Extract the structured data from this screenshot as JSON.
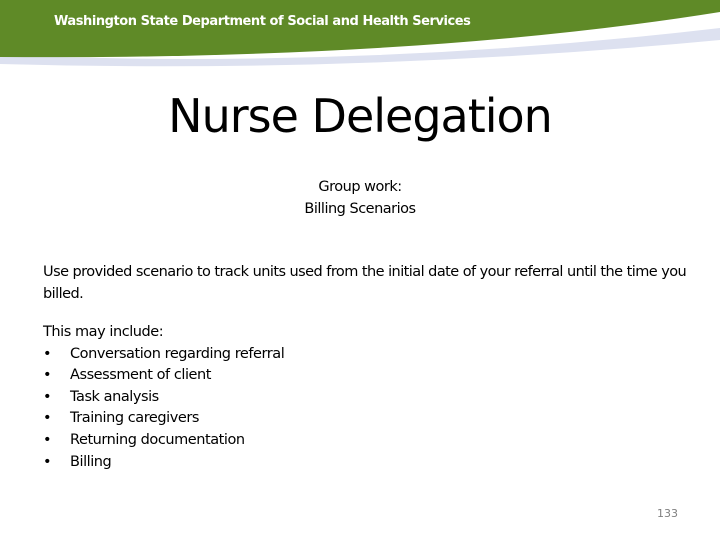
{
  "header": {
    "organization": "Washington State Department of Social and Health Services",
    "brand_color": "#5f8a27",
    "swoosh_color": "#dde1f0"
  },
  "slide": {
    "title": "Nurse Delegation",
    "subtitle_lines": [
      "Group work:",
      "Billing Scenarios"
    ],
    "instructions": "Use provided scenario to track units used from the initial date of your referral until the time you billed.",
    "list_intro": "This may include:",
    "bullet_glyph": "•",
    "items": [
      "Conversation regarding referral",
      "Assessment of client",
      "Task analysis",
      "Training caregivers",
      "Returning documentation",
      "Billing"
    ],
    "page_number": "133"
  }
}
